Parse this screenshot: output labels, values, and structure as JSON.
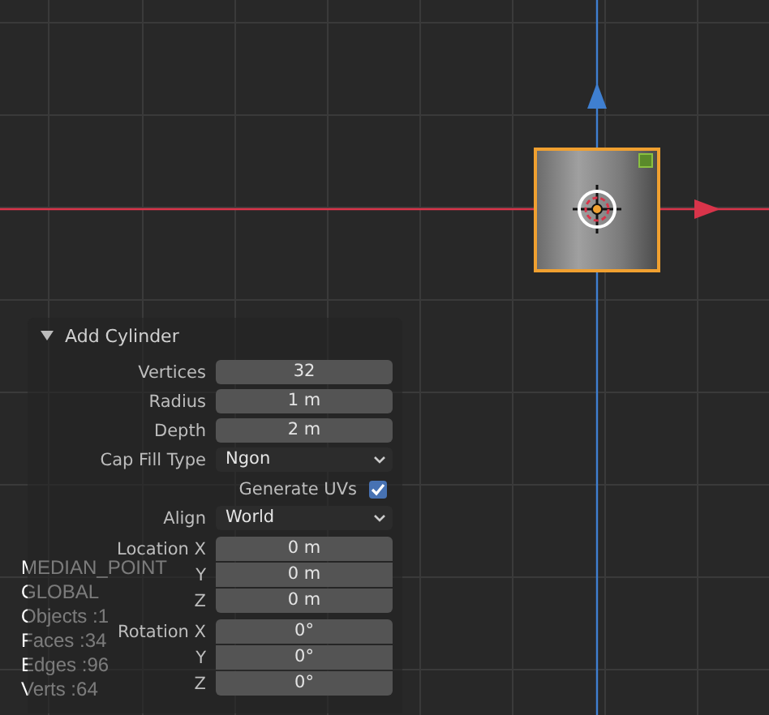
{
  "viewport": {
    "stats": [
      "MEDIAN_POINT",
      "GLOBAL",
      "Objects :1",
      "Faces :34",
      "Edges :96",
      "Verts :64"
    ]
  },
  "panel": {
    "title": "Add Cylinder",
    "expanded": true,
    "rows": [
      {
        "kind": "number",
        "label": "Vertices",
        "value": "32"
      },
      {
        "kind": "number",
        "label": "Radius",
        "value": "1 m"
      },
      {
        "kind": "number",
        "label": "Depth",
        "value": "2 m"
      },
      {
        "kind": "dropdown",
        "label": "Cap Fill Type",
        "value": "Ngon"
      },
      {
        "kind": "checkbox",
        "label": "Generate UVs",
        "checked": true
      },
      {
        "kind": "dropdown",
        "label": "Align",
        "value": "World"
      },
      {
        "kind": "vector",
        "items": [
          {
            "label": "Location X",
            "value": "0 m"
          },
          {
            "label": "Y",
            "value": "0 m"
          },
          {
            "label": "Z",
            "value": "0 m"
          }
        ]
      },
      {
        "kind": "vector",
        "items": [
          {
            "label": "Rotation X",
            "value": "0°"
          },
          {
            "label": "Y",
            "value": "0°"
          },
          {
            "label": "Z",
            "value": "0°"
          }
        ]
      }
    ]
  }
}
